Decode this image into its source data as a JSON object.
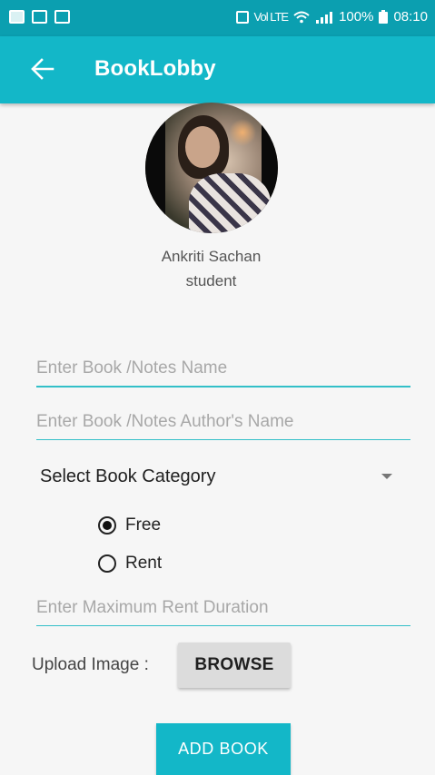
{
  "status_bar": {
    "battery": "100%",
    "time": "08:10",
    "signal_text": "Vol LTE",
    "icons": [
      "gallery-icon",
      "mail-icon",
      "image-icon",
      "sim-icon",
      "wifi-icon",
      "signal-icon",
      "battery-icon"
    ]
  },
  "toolbar": {
    "back_icon": "arrow-left-icon",
    "title": "BookLobby",
    "color": "#13b7c8"
  },
  "profile": {
    "name": "Ankriti Sachan",
    "role": "student"
  },
  "form": {
    "book_name_placeholder": "Enter Book /Notes Name",
    "book_name_value": "",
    "author_placeholder": "Enter Book /Notes Author's Name",
    "author_value": "",
    "category_label": "Select Book Category",
    "radio_options": [
      {
        "label": "Free",
        "checked": true
      },
      {
        "label": "Rent",
        "checked": false
      }
    ],
    "rent_duration_placeholder": "Enter Maximum Rent Duration",
    "rent_duration_value": "",
    "upload_label": "Upload Image :",
    "browse_label": "BROWSE",
    "submit_label": "ADD BOOK"
  },
  "colors": {
    "accent": "#13b7c8",
    "status_bar": "#0b9fb0",
    "underline": "#32bfc8"
  }
}
